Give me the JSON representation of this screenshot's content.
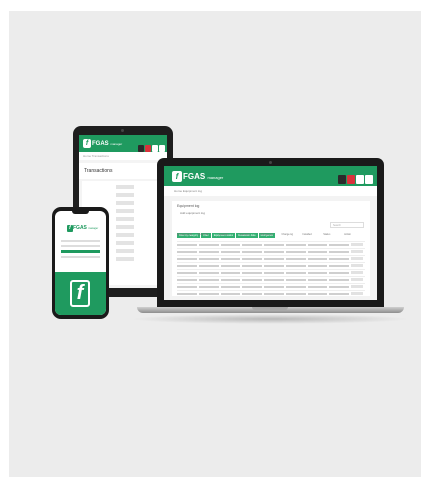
{
  "brand": {
    "mark": "f",
    "name": "FGAS",
    "tagline": "manager",
    "green": "#1f9a5f"
  },
  "tablet": {
    "breadcrumb": "Home   Transactions",
    "page_title": "Transactions"
  },
  "laptop": {
    "breadcrumb": "Home   Equipment log",
    "card_title": "Equipment log",
    "card_subtitle": "Add equipment log",
    "filters": [
      "Filter by category",
      "Filter",
      "Equipment status",
      "Installation date",
      "Refrigerant"
    ],
    "search_placeholder": "Search",
    "columns": [
      "Equipment ID",
      "Serial No.",
      "Location",
      "Category",
      "Refrigerant",
      "Charge kg",
      "Installed",
      "Status",
      "Action"
    ]
  },
  "phone": {
    "title": "FGAS"
  },
  "header_badge_colors": [
    "#2b2b2b",
    "#d9323c",
    "#ffffff",
    "#ffffff"
  ]
}
